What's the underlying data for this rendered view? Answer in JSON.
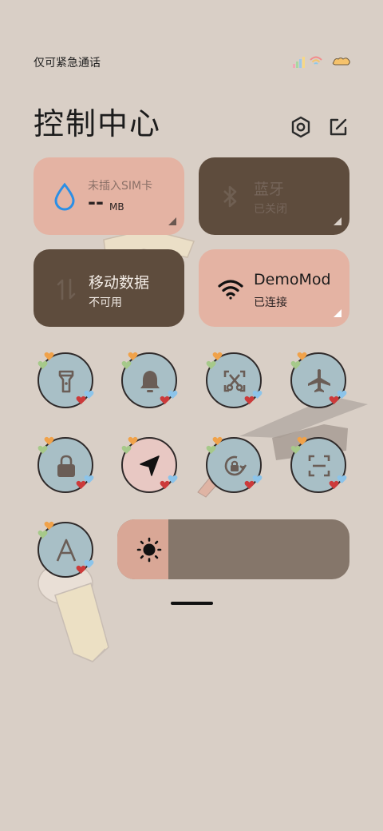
{
  "status_bar": {
    "carrier_text": "仅可紧急通话",
    "icons": [
      "signal-rainbow-icon",
      "wifi-rainbow-icon",
      "battery-icon"
    ]
  },
  "header": {
    "title": "控制中心",
    "settings_icon": "gear-icon",
    "edit_icon": "edit-icon"
  },
  "tiles": {
    "sim": {
      "label": "未插入SIM卡",
      "value": "--",
      "unit": "MB",
      "icon": "water-drop-icon",
      "color": "#e4b3a3"
    },
    "bluetooth": {
      "label": "蓝牙",
      "status": "已关闭",
      "icon": "bluetooth-icon",
      "color": "#5e4c3d"
    },
    "mobile_data": {
      "label": "移动数据",
      "status": "不可用",
      "icon": "data-arrows-icon",
      "color": "#5e4c3d"
    },
    "wifi": {
      "label": "DemoMod",
      "status": "已连接",
      "icon": "wifi-icon",
      "color": "#e4b3a3"
    }
  },
  "toggles": [
    {
      "name": "flashlight",
      "icon": "flashlight-icon",
      "active": false
    },
    {
      "name": "bell",
      "icon": "bell-icon",
      "active": false
    },
    {
      "name": "screenshot",
      "icon": "screenshot-scissors-icon",
      "active": false
    },
    {
      "name": "airplane",
      "icon": "airplane-icon",
      "active": false
    },
    {
      "name": "lock",
      "icon": "lock-icon",
      "active": false
    },
    {
      "name": "location",
      "icon": "location-arrow-icon",
      "active": true
    },
    {
      "name": "rotation-lock",
      "icon": "rotation-lock-icon",
      "active": false
    },
    {
      "name": "scan",
      "icon": "scan-icon",
      "active": false
    },
    {
      "name": "reading-mode",
      "icon": "font-a-icon",
      "active": false
    }
  ],
  "brightness": {
    "icon": "sun-icon",
    "level": 0.22
  },
  "colors": {
    "background": "#d9cfc6",
    "tile_light": "#e4b3a3",
    "tile_dark": "#5e4c3d",
    "toggle_off": "#a8bfc6",
    "toggle_on": "#e8c8c3",
    "slider_track": "#85766a",
    "slider_fill": "#d9a796"
  }
}
